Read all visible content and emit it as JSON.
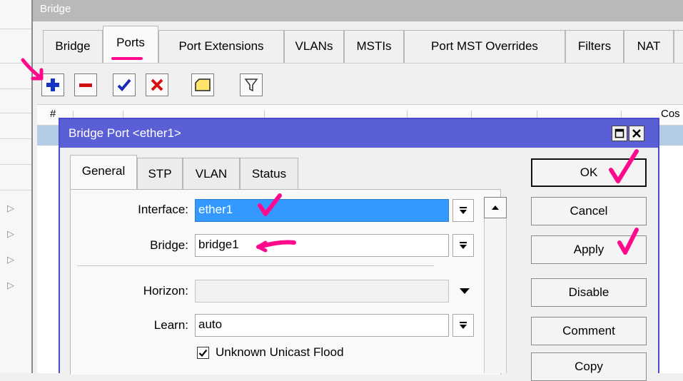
{
  "parent_window": {
    "title": "Bridge",
    "tabs": [
      "Bridge",
      "Ports",
      "Port Extensions",
      "VLANs",
      "MSTIs",
      "Port MST Overrides",
      "Filters",
      "NAT"
    ],
    "active_tab": "Ports",
    "table_headers": {
      "first": "#",
      "last": "Cos"
    }
  },
  "toolbar": {
    "buttons": [
      {
        "name": "add",
        "icon": "plus-icon",
        "color": "#1533c6"
      },
      {
        "name": "remove",
        "icon": "minus-icon",
        "color": "#d01010"
      },
      {
        "name": "enable",
        "icon": "check-icon",
        "color": "#1a2cb5"
      },
      {
        "name": "disable",
        "icon": "x-icon",
        "color": "#d81010"
      },
      {
        "name": "comment",
        "icon": "note-icon",
        "color": "#ffe36b"
      },
      {
        "name": "filter",
        "icon": "funnel-icon",
        "color": "#333333"
      }
    ]
  },
  "dialog": {
    "title": "Bridge Port <ether1>",
    "tabs": [
      "General",
      "STP",
      "VLAN",
      "Status"
    ],
    "active_tab": "General",
    "fields": {
      "interface": {
        "label": "Interface:",
        "value": "ether1"
      },
      "bridge": {
        "label": "Bridge:",
        "value": "bridge1"
      },
      "horizon": {
        "label": "Horizon:",
        "value": ""
      },
      "learn": {
        "label": "Learn:",
        "value": "auto"
      }
    },
    "unknown_unicast_flood": {
      "label": "Unknown Unicast Flood",
      "checked": true
    },
    "buttons": [
      "OK",
      "Cancel",
      "Apply",
      "Disable",
      "Comment",
      "Copy"
    ]
  },
  "colors": {
    "dialog_title_bg": "#5b5fd6",
    "annotation": "#ff0a8c",
    "selection": "#3399ff",
    "selected_row": "#b4cbe6"
  }
}
